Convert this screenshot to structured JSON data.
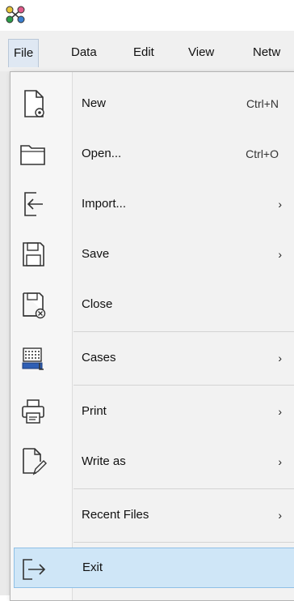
{
  "menubar": {
    "items": [
      {
        "label": "File"
      },
      {
        "label": "Data"
      },
      {
        "label": "Edit"
      },
      {
        "label": "View"
      },
      {
        "label": "Netw"
      }
    ]
  },
  "file_menu": {
    "items": [
      {
        "label": "New",
        "shortcut": "Ctrl+N",
        "icon": "new-document-icon"
      },
      {
        "label": "Open...",
        "shortcut": "Ctrl+O",
        "icon": "folder-icon"
      },
      {
        "label": "Import...",
        "submenu": "›",
        "icon": "import-icon"
      },
      {
        "label": "Save",
        "submenu": "›",
        "icon": "save-icon"
      },
      {
        "label": "Close",
        "icon": "close-file-icon"
      },
      {
        "label": "Cases",
        "submenu": "›",
        "icon": "cases-icon"
      },
      {
        "label": "Print",
        "submenu": "›",
        "icon": "printer-icon"
      },
      {
        "label": "Write as",
        "submenu": "›",
        "icon": "write-as-icon"
      },
      {
        "label": "Recent Files",
        "submenu": "›"
      },
      {
        "label": "Exit",
        "icon": "exit-icon"
      }
    ]
  },
  "colors": {
    "hover_bg": "#cfe6f7",
    "hover_border": "#8fc0e6",
    "menu_bg": "#f2f2f2"
  }
}
